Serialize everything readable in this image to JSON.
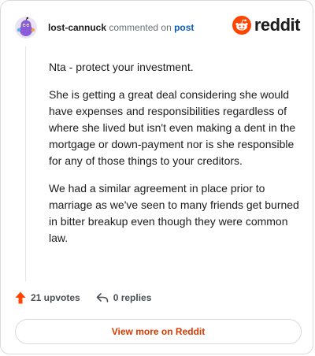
{
  "header": {
    "author": "lost-cannuck",
    "action": "commented on",
    "target": "post",
    "brand": "reddit"
  },
  "comment": {
    "paragraphs": [
      "Nta - protect your investment.",
      "She is getting a great deal considering she would have expenses and responsibilities regardless of where she lived but isn't even making a dent in the mortgage or down-payment nor is she responsible for any of those things to your creditors.",
      "We had a similar agreement in place prior to marriage as we've seen to many friends get burned in bitter breakup even though they were common law."
    ]
  },
  "footer": {
    "upvotes": "21 upvotes",
    "replies": "0 replies"
  },
  "cta": {
    "label": "View more on Reddit"
  },
  "colors": {
    "brand_orange": "#ff4500",
    "cta_text": "#d93a00",
    "link_blue": "#0a5fba",
    "avatar_purple": "#8a5cd6"
  },
  "icons": {
    "avatar": "snoo-avatar",
    "logo": "reddit-alien-icon",
    "upvote": "upvote-arrow-icon",
    "reply": "reply-arrow-icon"
  }
}
